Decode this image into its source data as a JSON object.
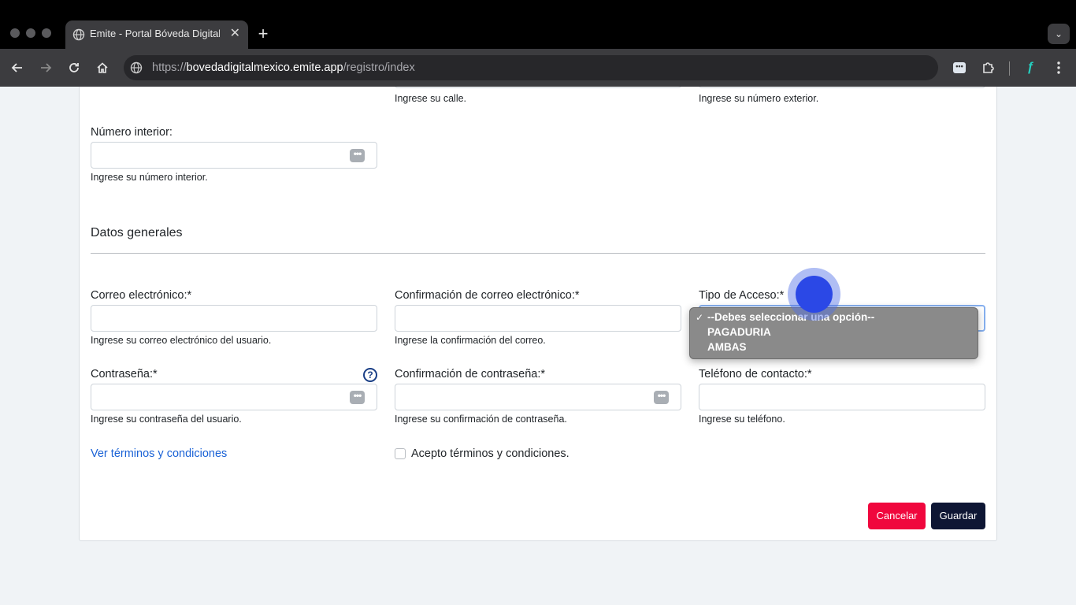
{
  "browser": {
    "tab_title": "Emite - Portal Bóveda Digital",
    "url_scheme": "https://",
    "url_host": "bovedadigitalmexico.emite.app",
    "url_path": "/registro/index"
  },
  "form": {
    "top_helpers": {
      "calle": "Ingrese su calle.",
      "numero_exterior": "Ingrese su número exterior."
    },
    "numero_interior": {
      "label": "Número interior:",
      "help": "Ingrese su número interior."
    },
    "section_title": "Datos generales",
    "correo": {
      "label": "Correo electrónico:*",
      "help": "Ingrese su correo electrónico del usuario."
    },
    "confirmacion_correo": {
      "label": "Confirmación de correo electrónico:*",
      "help": "Ingrese la confirmación del correo."
    },
    "tipo_acceso": {
      "label": "Tipo de Acceso:*",
      "options": [
        "--Debes seleccionar una opción--",
        "PAGADURIA",
        "AMBAS"
      ],
      "selected_check": "✓"
    },
    "contrasena": {
      "label": "Contraseña:*",
      "help": "Ingrese su contraseña del usuario.",
      "help_icon": "?"
    },
    "confirmacion_contrasena": {
      "label": "Confirmación de contraseña:*",
      "help": "Ingrese su confirmación de contraseña."
    },
    "telefono": {
      "label": "Teléfono de contacto:*",
      "help": "Ingrese su teléfono."
    },
    "terms_link": "Ver términos y condiciones",
    "terms_checkbox_label": "Acepto términos y condiciones.",
    "cancel_button": "Cancelar",
    "save_button": "Guardar"
  }
}
